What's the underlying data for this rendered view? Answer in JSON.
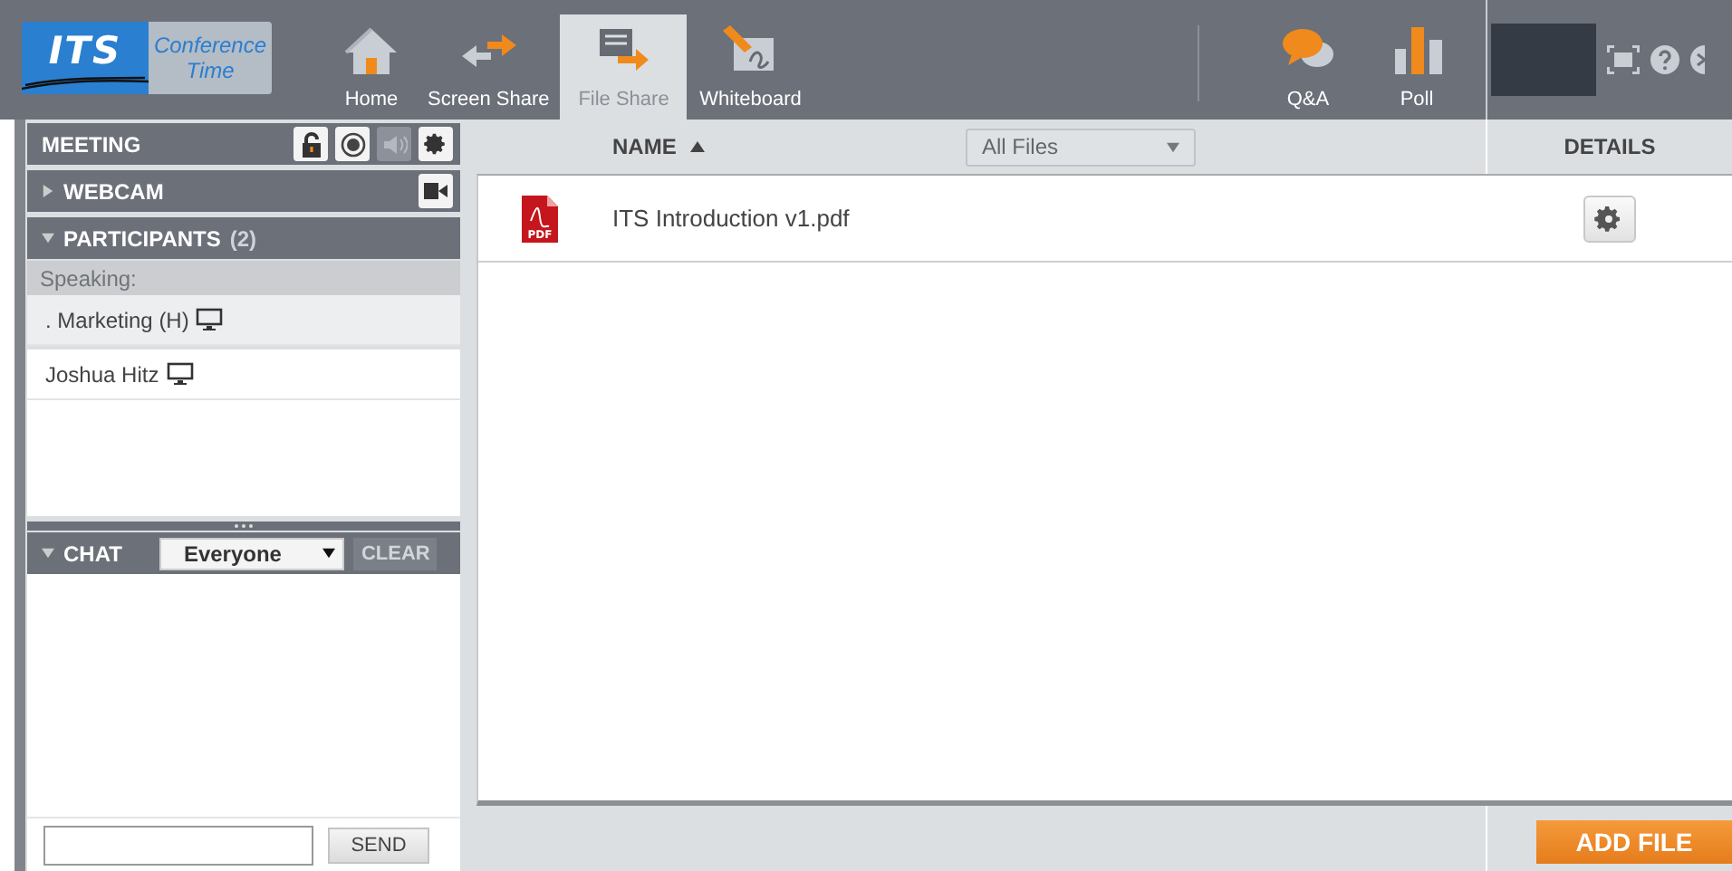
{
  "logo": {
    "brand": "ITS",
    "tagline_1": "Conference",
    "tagline_2": "Time"
  },
  "nav": [
    {
      "label": "Home",
      "kind": "home",
      "selected": false
    },
    {
      "label": "Screen Share",
      "kind": "screen",
      "selected": false
    },
    {
      "label": "File Share",
      "kind": "file",
      "selected": true
    },
    {
      "label": "Whiteboard",
      "kind": "whiteboard",
      "selected": false
    }
  ],
  "nav_right": [
    {
      "label": "Q&A",
      "kind": "qa",
      "selected": false
    },
    {
      "label": "Poll",
      "kind": "poll",
      "selected": false
    }
  ],
  "sidebar": {
    "meeting": {
      "title": "MEETING",
      "tools": [
        {
          "kind": "lock",
          "disabled": false
        },
        {
          "kind": "record",
          "disabled": false
        },
        {
          "kind": "audio",
          "disabled": true
        },
        {
          "kind": "settings",
          "disabled": false
        }
      ]
    },
    "webcam": {
      "title": "WEBCAM",
      "expanded": false
    },
    "participants": {
      "title": "PARTICIPANTS",
      "count": "(2)",
      "expanded": true,
      "speaking_label": "Speaking:",
      "speakers": [
        {
          "name": ". Marketing (H)"
        }
      ],
      "others": [
        {
          "name": "Joshua Hitz"
        }
      ]
    },
    "chat": {
      "title": "CHAT",
      "expanded": true,
      "recipient": "Everyone",
      "clear": {
        "label": "CLEAR",
        "disabled": true
      },
      "send": "SEND"
    }
  },
  "files": {
    "columns": {
      "name": "NAME",
      "sorted_ascending": true,
      "details": "DETAILS"
    },
    "filter": "All Files",
    "rows": [
      {
        "name": "ITS Introduction v1.pdf",
        "icon_text": "PDF"
      }
    ],
    "add_button": "ADD FILE"
  }
}
